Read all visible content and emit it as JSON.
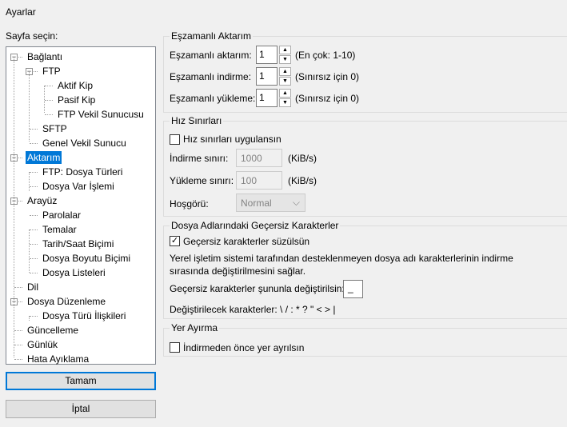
{
  "window_title": "Ayarlar",
  "sidebar": {
    "label": "Sayfa seçin:",
    "items": [
      {
        "label": "Bağlantı",
        "level": 0,
        "expanded": true
      },
      {
        "label": "FTP",
        "level": 1,
        "expanded": true
      },
      {
        "label": "Aktif Kip",
        "level": 2
      },
      {
        "label": "Pasif Kip",
        "level": 2
      },
      {
        "label": "FTP Vekil Sunucusu",
        "level": 2
      },
      {
        "label": "SFTP",
        "level": 1
      },
      {
        "label": "Genel Vekil Sunucu",
        "level": 1
      },
      {
        "label": "Aktarım",
        "level": 0,
        "expanded": true,
        "selected": true
      },
      {
        "label": "FTP: Dosya Türleri",
        "level": 1
      },
      {
        "label": "Dosya Var İşlemi",
        "level": 1
      },
      {
        "label": "Arayüz",
        "level": 0,
        "expanded": true
      },
      {
        "label": "Parolalar",
        "level": 1
      },
      {
        "label": "Temalar",
        "level": 1
      },
      {
        "label": "Tarih/Saat Biçimi",
        "level": 1
      },
      {
        "label": "Dosya Boyutu Biçimi",
        "level": 1
      },
      {
        "label": "Dosya Listeleri",
        "level": 1
      },
      {
        "label": "Dil",
        "level": 0
      },
      {
        "label": "Dosya Düzenleme",
        "level": 0,
        "expanded": true
      },
      {
        "label": "Dosya Türü İlişkileri",
        "level": 1
      },
      {
        "label": "Güncelleme",
        "level": 0
      },
      {
        "label": "Günlük",
        "level": 0
      },
      {
        "label": "Hata Ayıklama",
        "level": 0
      }
    ]
  },
  "buttons": {
    "ok": "Tamam",
    "cancel": "İptal"
  },
  "concurrent": {
    "title": "Eşzamanlı Aktarım",
    "transfers": {
      "label": "Eşzamanlı aktarım:",
      "value": "1",
      "hint": "(En çok: 1-10)"
    },
    "downloads": {
      "label": "Eşzamanlı indirme:",
      "value": "1",
      "hint": "(Sınırsız için 0)"
    },
    "uploads": {
      "label": "Eşzamanlı yükleme:",
      "value": "1",
      "hint": "(Sınırsız için 0)"
    }
  },
  "speed": {
    "title": "Hız Sınırları",
    "enable_label": "Hız sınırları uygulansın",
    "enable_checked": false,
    "download": {
      "label": "İndirme sınırı:",
      "value": "1000",
      "unit": "(KiB/s)"
    },
    "upload": {
      "label": "Yükleme sınırı:",
      "value": "100",
      "unit": "(KiB/s)"
    },
    "tolerance": {
      "label": "Hoşgörü:",
      "value": "Normal"
    }
  },
  "invalid": {
    "title": "Dosya Adlarındaki Geçersiz Karakterler",
    "filter_label": "Geçersiz karakterler süzülsün",
    "filter_checked": true,
    "desc1": "Yerel işletim sistemi tarafından desteklenmeyen dosya adı karakterlerinin indirme",
    "desc2": "sırasında değiştirilmesini sağlar.",
    "replace_label": "Geçersiz karakterler şununla değiştirilsin:",
    "replace_value": "_",
    "chars_label": "Değiştirilecek karakterler: \\ / : * ? \" < > |"
  },
  "prealloc": {
    "title": "Yer Ayırma",
    "label": "İndirmeden önce yer ayrılsın",
    "checked": false
  }
}
